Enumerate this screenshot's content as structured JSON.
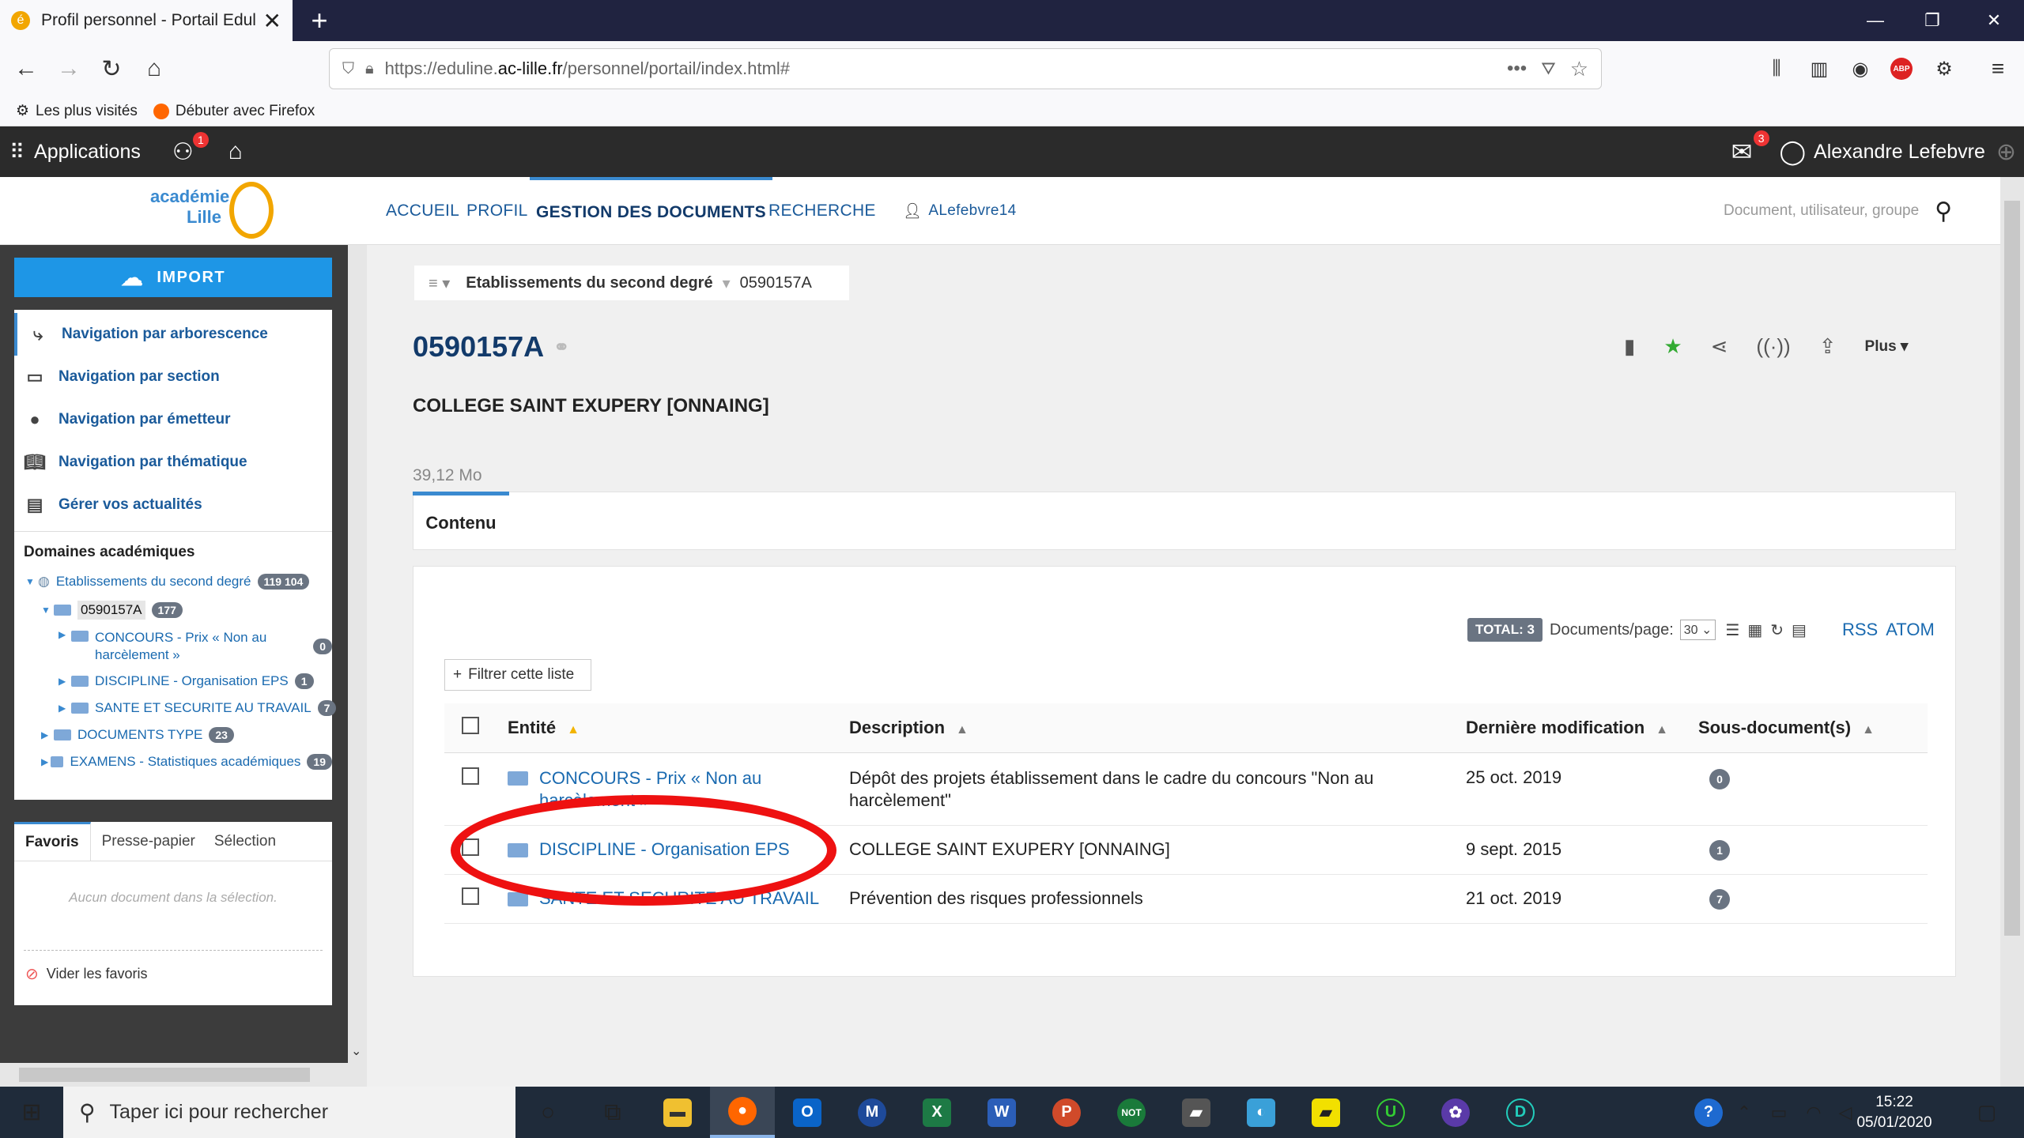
{
  "browser": {
    "tab_title": "Profil personnel - Portail Edulin",
    "url_prefix": "https://eduline.",
    "url_host": "ac-lille.fr",
    "url_path": "/personnel/portail/index.html#",
    "bookmarks": [
      "Les plus visités",
      "Débuter avec Firefox"
    ]
  },
  "appbar": {
    "applications": "Applications",
    "apps_badge": "1",
    "mail_badge": "3",
    "user_name": "Alexandre Lefebvre"
  },
  "site": {
    "logo_line1": "académie",
    "logo_line2": "Lille",
    "nav": [
      "ACCUEIL",
      "PROFIL",
      "GESTION DES DOCUMENTS",
      "RECHERCHE"
    ],
    "username": "ALefebvre14",
    "search_placeholder": "Document, utilisateur, groupe"
  },
  "left": {
    "import": "IMPORT",
    "nav_links": [
      "Navigation par arborescence",
      "Navigation par section",
      "Navigation par émetteur",
      "Navigation par thématique",
      "Gérer vos actualités"
    ],
    "domains_title": "Domaines académiques",
    "tree": {
      "root": {
        "label": "Etablissements du second degré",
        "count": "119 104"
      },
      "node": {
        "label": "0590157A",
        "count": "177"
      },
      "children": [
        {
          "label1": "CONCOURS - Prix « Non au",
          "label2": "harcèlement »",
          "count": "0"
        },
        {
          "label1": "DISCIPLINE - Organisation EPS",
          "count": "1"
        },
        {
          "label1": "SANTE ET SECURITE AU TRAVAIL",
          "count": "7"
        }
      ],
      "siblings": [
        {
          "label": "DOCUMENTS TYPE",
          "count": "23"
        },
        {
          "label": "EXAMENS - Statistiques académiques",
          "count": "19"
        }
      ]
    },
    "fav_tabs": [
      "Favoris",
      "Presse-papier",
      "Sélection"
    ],
    "fav_empty": "Aucun document dans la sélection.",
    "fav_clear": "Vider les favoris"
  },
  "content": {
    "breadcrumb": [
      "Etablissements du second degré",
      "0590157A"
    ],
    "title": "0590157A",
    "subtitle": "COLLEGE SAINT EXUPERY [ONNAING]",
    "size": "39,12 Mo",
    "more": "Plus",
    "tab": "Contenu",
    "total": "TOTAL: 3",
    "per_page_label": "Documents/page:",
    "per_page_value": "30",
    "rss": "RSS",
    "atom": "ATOM",
    "filter": "Filtrer cette liste",
    "columns": [
      "Entité",
      "Description",
      "Dernière modification",
      "Sous-document(s)"
    ],
    "rows": [
      {
        "entity": "CONCOURS - Prix « Non au harcèlement »",
        "desc1": "Dépôt des projets établissement dans le cadre du concours \"Non au",
        "desc2": "harcèlement\"",
        "date": "25 oct. 2019",
        "subs": "0"
      },
      {
        "entity": "DISCIPLINE - Organisation EPS",
        "desc1": "COLLEGE SAINT EXUPERY [ONNAING]",
        "date": "9 sept. 2015",
        "subs": "1"
      },
      {
        "entity": "SANTE ET SECURITE AU TRAVAIL",
        "desc1": "Prévention des risques professionnels",
        "date": "21 oct. 2019",
        "subs": "7"
      }
    ]
  },
  "taskbar": {
    "search": "Taper ici pour rechercher",
    "time": "15:22",
    "date": "05/01/2020"
  },
  "colors": {
    "accent": "#1e96e6",
    "highlight": "#e11111",
    "dark": "#2b2b2b"
  }
}
